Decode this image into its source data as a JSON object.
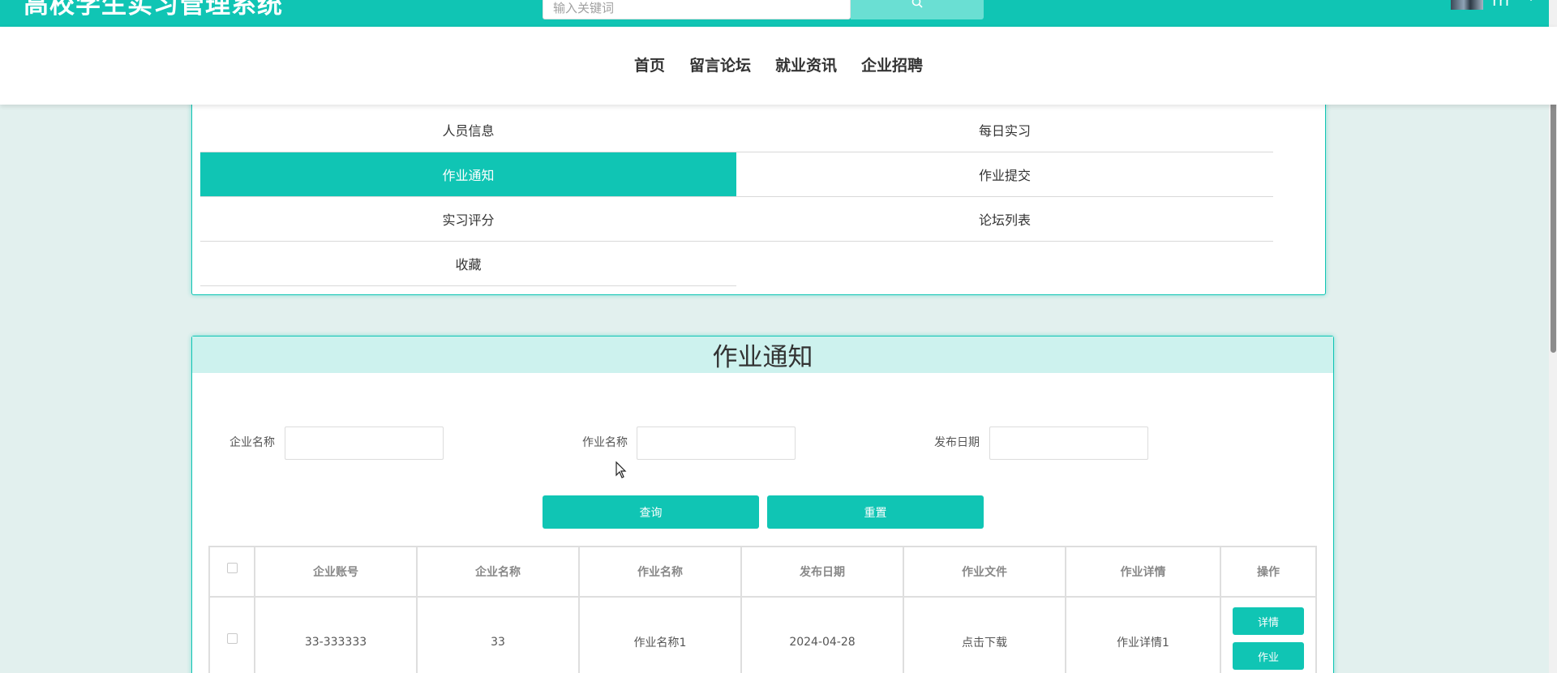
{
  "header": {
    "brand": "高校学生实习管理系统",
    "search": {
      "placeholder": "输入关键词",
      "icon": "search-icon"
    },
    "user": {
      "name": "rrr",
      "icon": "chevron-down-icon"
    }
  },
  "nav": {
    "items": [
      "首页",
      "留言论坛",
      "就业资讯",
      "企业招聘"
    ]
  },
  "menu": {
    "items": [
      {
        "label": "人员信息",
        "active": false
      },
      {
        "label": "每日实习",
        "active": false
      },
      {
        "label": "作业通知",
        "active": true
      },
      {
        "label": "作业提交",
        "active": false
      },
      {
        "label": "实习评分",
        "active": false
      },
      {
        "label": "论坛列表",
        "active": false
      },
      {
        "label": "收藏",
        "active": false
      }
    ]
  },
  "notice": {
    "title": "作业通知",
    "filters": {
      "company_name_label": "企业名称",
      "company_name_value": "",
      "homework_name_label": "作业名称",
      "homework_name_value": "",
      "publish_date_label": "发布日期",
      "publish_date_value": ""
    },
    "query_button": "查询",
    "reset_button": "重置",
    "table": {
      "headers": [
        "企业账号",
        "企业名称",
        "作业名称",
        "发布日期",
        "作业文件",
        "作业详情",
        "操作"
      ],
      "rows": [
        {
          "account": "33-333333",
          "company": "33",
          "homework": "作业名称1",
          "date": "2024-04-28",
          "file": "点击下载",
          "detail": "作业详情1",
          "actions": [
            "详情",
            "作业"
          ]
        }
      ]
    }
  },
  "colors": {
    "accent": "#10c5b4",
    "page_background": "#e2f0ee",
    "header_band": "#cdf2ee"
  }
}
